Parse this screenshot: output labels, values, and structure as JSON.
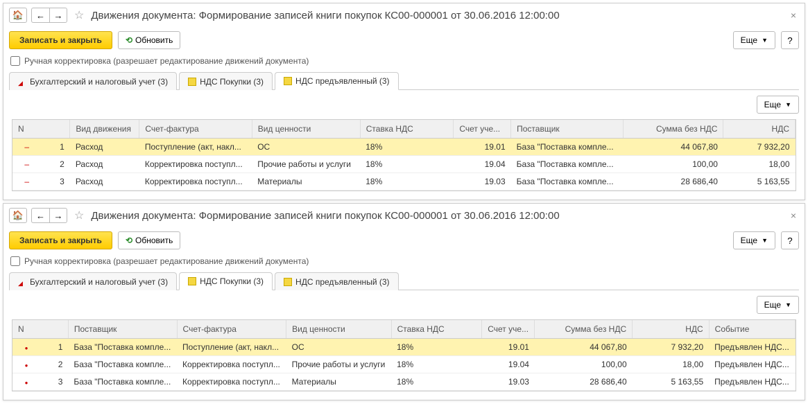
{
  "window1": {
    "title": "Движения документа: Формирование записей книги покупок КС00-000001 от 30.06.2016 12:00:00",
    "save_close": "Записать и закрыть",
    "refresh": "Обновить",
    "more": "Еще",
    "manual_edit": "Ручная корректировка (разрешает редактирование движений документа)",
    "tabs": [
      "Бухгалтерский и налоговый учет (3)",
      "НДС Покупки (3)",
      "НДС предъявленный (3)"
    ],
    "headers": [
      "N",
      "",
      "Вид движения",
      "Счет-фактура",
      "Вид ценности",
      "Ставка НДС",
      "Счет уче...",
      "Поставщик",
      "Сумма без НДС",
      "НДС"
    ],
    "rows": [
      {
        "mark": "–",
        "n": "1",
        "move": "Расход",
        "sf": "Поступление (акт, накл...",
        "val": "ОС",
        "rate": "18%",
        "acc": "19.01",
        "supp": "База \"Поставка компле...",
        "sum": "44 067,80",
        "vat": "7 932,20"
      },
      {
        "mark": "–",
        "n": "2",
        "move": "Расход",
        "sf": "Корректировка поступл...",
        "val": "Прочие работы и услуги",
        "rate": "18%",
        "acc": "19.04",
        "supp": "База \"Поставка компле...",
        "sum": "100,00",
        "vat": "18,00"
      },
      {
        "mark": "–",
        "n": "3",
        "move": "Расход",
        "sf": "Корректировка поступл...",
        "val": "Материалы",
        "rate": "18%",
        "acc": "19.03",
        "supp": "База \"Поставка компле...",
        "sum": "28 686,40",
        "vat": "5 163,55"
      }
    ]
  },
  "window2": {
    "title": "Движения документа: Формирование записей книги покупок КС00-000001 от 30.06.2016 12:00:00",
    "save_close": "Записать и закрыть",
    "refresh": "Обновить",
    "more": "Еще",
    "manual_edit": "Ручная корректировка (разрешает редактирование движений документа)",
    "tabs": [
      "Бухгалтерский и налоговый учет (3)",
      "НДС Покупки (3)",
      "НДС предъявленный (3)"
    ],
    "headers": [
      "N",
      "",
      "Поставщик",
      "Счет-фактура",
      "Вид ценности",
      "Ставка НДС",
      "Счет уче...",
      "Сумма без НДС",
      "НДС",
      "Событие"
    ],
    "rows": [
      {
        "n": "1",
        "supp": "База \"Поставка компле...",
        "sf": "Поступление (акт, накл...",
        "val": "ОС",
        "rate": "18%",
        "acc": "19.01",
        "sum": "44 067,80",
        "vat": "7 932,20",
        "evt": "Предъявлен НДС..."
      },
      {
        "n": "2",
        "supp": "База \"Поставка компле...",
        "sf": "Корректировка поступл...",
        "val": "Прочие работы и услуги",
        "rate": "18%",
        "acc": "19.04",
        "sum": "100,00",
        "vat": "18,00",
        "evt": "Предъявлен НДС..."
      },
      {
        "n": "3",
        "supp": "База \"Поставка компле...",
        "sf": "Корректировка поступл...",
        "val": "Материалы",
        "rate": "18%",
        "acc": "19.03",
        "sum": "28 686,40",
        "vat": "5 163,55",
        "evt": "Предъявлен НДС..."
      }
    ]
  }
}
